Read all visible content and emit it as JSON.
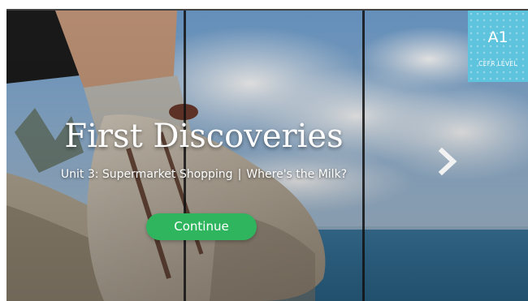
{
  "hero": {
    "title": "First Discoveries",
    "unit": "Unit 3: Supermarket Shopping",
    "separator": "|",
    "lesson": "Where's the Milk?",
    "continue_label": "Continue"
  },
  "level_badge": {
    "code": "A1",
    "caption": "CEFR LEVEL",
    "color": "#5ec3dd"
  },
  "navigation": {
    "next_icon": "chevron-right-icon"
  },
  "colors": {
    "continue_button": "#2eb55e",
    "text": "#ffffff"
  }
}
